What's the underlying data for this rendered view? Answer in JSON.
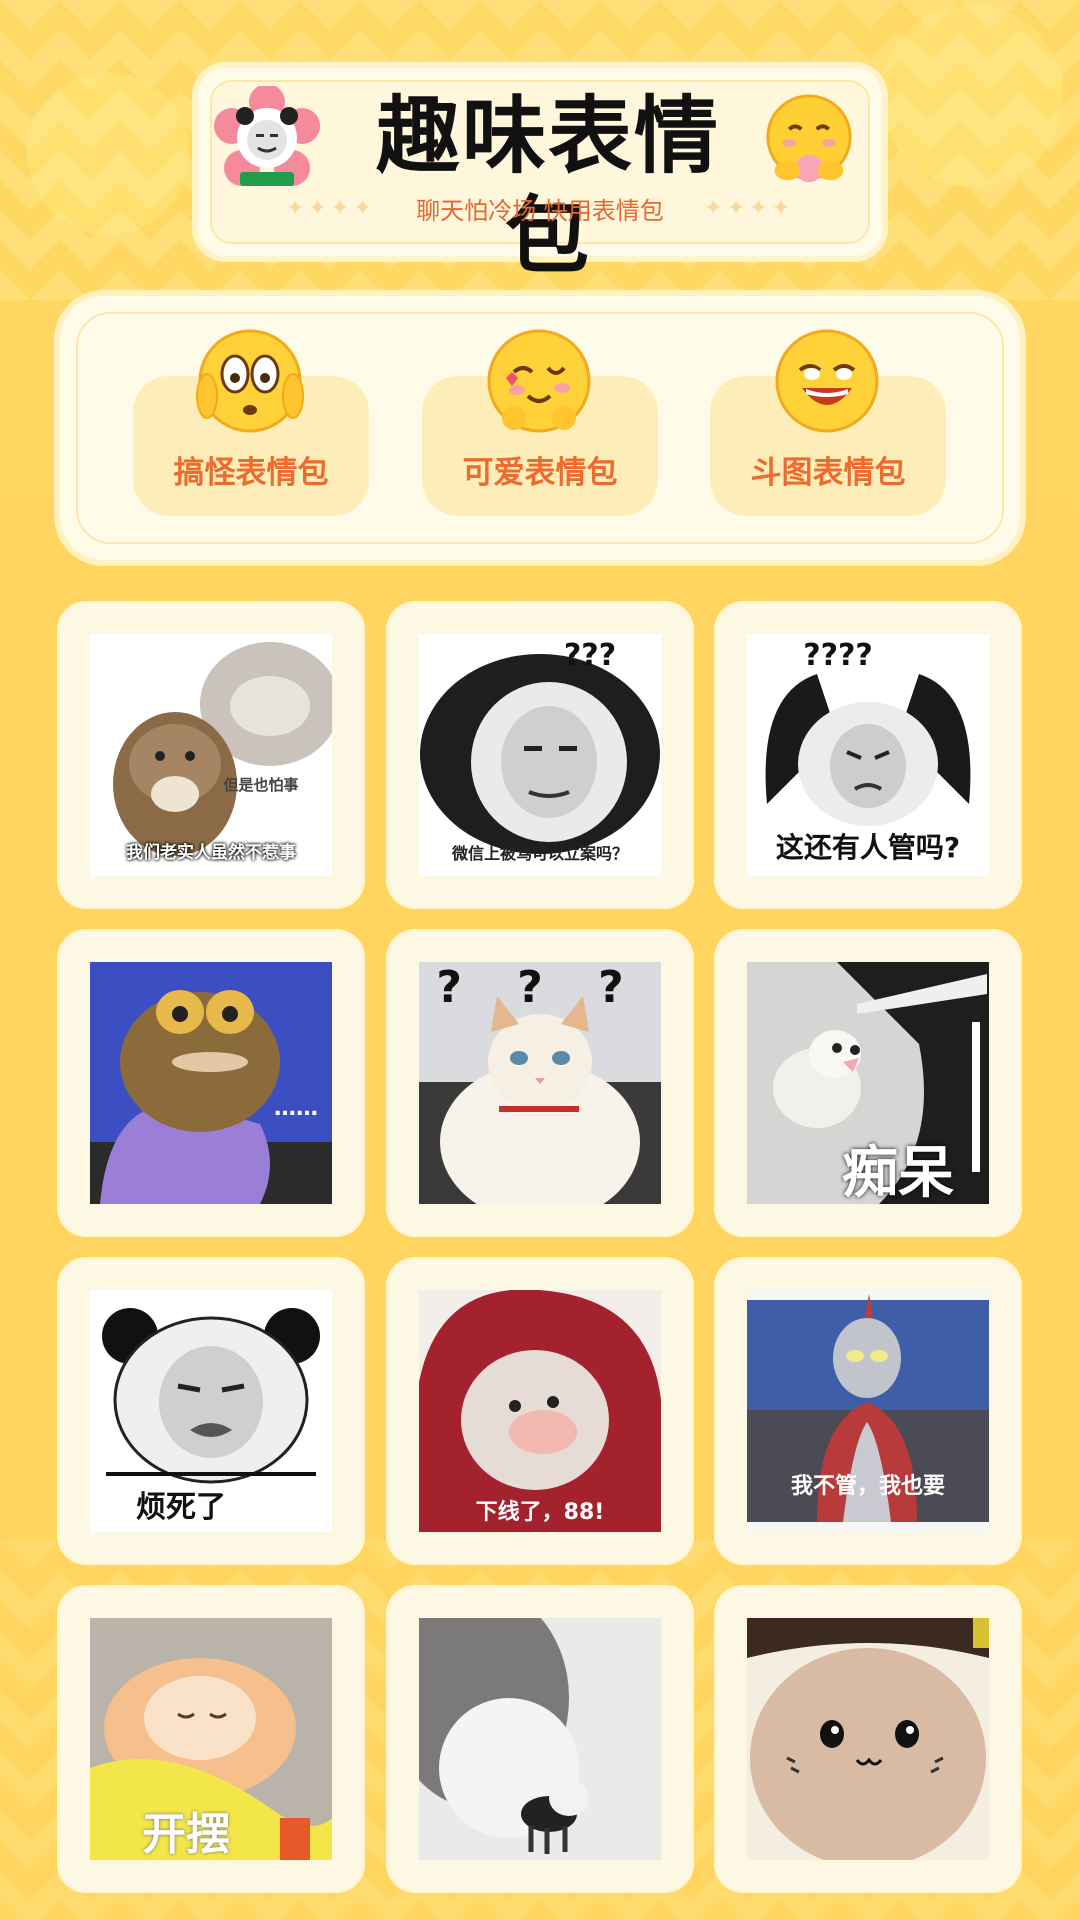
{
  "header": {
    "title": "趣味表情包",
    "subtitle": "聊天怕冷场 快用表情包",
    "stars": "✦✦✦✦"
  },
  "categories": [
    {
      "label": "搞怪表情包",
      "icon": "shocked-face-icon"
    },
    {
      "label": "可爱表情包",
      "icon": "wink-heart-face-icon"
    },
    {
      "label": "斗图表情包",
      "icon": "laughing-face-icon"
    }
  ],
  "stickers": [
    {
      "caption": "我们老实人虽然不惹事",
      "caption2": "但是也怕事",
      "icon": "cat-meme"
    },
    {
      "caption": "微信上被骂可以立案吗？",
      "marks": "???",
      "icon": "panda-meme"
    },
    {
      "caption": "这还有人管吗?",
      "marks": "????",
      "icon": "panda-raised-hands-meme"
    },
    {
      "caption": "……",
      "icon": "fish-man-meme"
    },
    {
      "caption": "",
      "marks": "? ? ?",
      "icon": "confused-cat-meme"
    },
    {
      "caption": "痴呆",
      "icon": "bird-meme"
    },
    {
      "caption": "烦死了",
      "icon": "panda-annoyed-meme"
    },
    {
      "caption": "下线了，88!",
      "icon": "hooded-duck-meme"
    },
    {
      "caption": "我不管，我也要",
      "icon": "ultraman-meme"
    },
    {
      "caption": "开摆",
      "icon": "sleeping-cat-meme"
    },
    {
      "caption": "",
      "icon": "cat-with-cat-meme"
    },
    {
      "caption": "",
      "icon": "chiikawa-meme"
    }
  ],
  "colors": {
    "background": "#ffd55f",
    "card": "#fdf8e4",
    "accent": "#ec6c30"
  }
}
